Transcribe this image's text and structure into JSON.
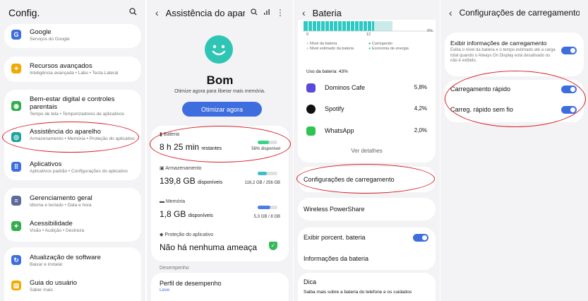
{
  "p1": {
    "title": "Config.",
    "items": [
      {
        "title": "Google",
        "sub": "Serviços do Google",
        "color": "#3d6de0",
        "glyph": "G"
      },
      {
        "title": "Recursos avançados",
        "sub": "Inteligência avançada • Labs • Tecla Lateral",
        "color": "#f2a900",
        "glyph": "✦"
      },
      {
        "title": "Bem-estar digital e controles parentais",
        "sub": "Tempo de tela • Temporizadores de aplicativos",
        "color": "#2fae4b",
        "glyph": "◉"
      },
      {
        "title": "Assistência do aparelho",
        "sub": "Armazenamento • Memória • Proteção do aplicativo",
        "color": "#1aa39a",
        "glyph": "◎"
      },
      {
        "title": "Aplicativos",
        "sub": "Aplicativos padrão • Configurações do aplicativo",
        "color": "#3d6de0",
        "glyph": "⠿"
      },
      {
        "title": "Gerenciamento geral",
        "sub": "Idioma e teclado • Data e hora",
        "color": "#5a6a9a",
        "glyph": "≡"
      },
      {
        "title": "Acessibilidade",
        "sub": "Visão • Audição • Destreza",
        "color": "#2fae4b",
        "glyph": "✦"
      },
      {
        "title": "Atualização de software",
        "sub": "Baixar e instalar",
        "color": "#3d6de0",
        "glyph": "↻"
      },
      {
        "title": "Guia do usuário",
        "sub": "Saber mais",
        "color": "#f2a900",
        "glyph": "▤"
      }
    ]
  },
  "p2": {
    "title": "Assistência do apar...",
    "status": "Bom",
    "status_sub": "Otimize agora para liberar mais memória.",
    "optimize": "Otimizar agora",
    "battery": {
      "label": "Bateria",
      "value": "8 h 25 min",
      "unit": "restantes",
      "pct_text": "56% disponível",
      "level": 0.56
    },
    "storage": {
      "label": "Armazenamento",
      "value": "139,8 GB",
      "unit": "disponíveis",
      "detail": "116,2 GB / 256 GB",
      "level": 0.45
    },
    "memory": {
      "label": "Memória",
      "value": "1,8 GB",
      "unit": "disponíveis",
      "detail": "5,3 GB / 8 GB",
      "level": 0.66
    },
    "protection": {
      "label": "Proteção do aplicativo",
      "value": "Não há nenhuma ameaça"
    },
    "section": "Desempenho",
    "perf": {
      "title": "Perfil de desempenho",
      "sub": "Leve"
    }
  },
  "p3": {
    "title": "Bateria",
    "axis": [
      "0",
      "12",
      "0%"
    ],
    "legend": [
      "Nível da bateria",
      "Carregando",
      "Nível estimado da bateria",
      "Economia de energia"
    ],
    "usage": "Uso da bateria: 43%",
    "apps": [
      {
        "name": "Dominos Cafe",
        "pct": "5,8%",
        "color": "#5b4ad9"
      },
      {
        "name": "Spotify",
        "pct": "4,2%",
        "color": "#111"
      },
      {
        "name": "WhatsApp",
        "pct": "2,0%",
        "color": "#2fc34f"
      }
    ],
    "more": "Ver detalhes",
    "charging": "Configurações de carregamento",
    "wireless": "Wireless PowerShare",
    "show_pct": "Exibir porcent. bateria",
    "info": "Informações da bateria",
    "tip": "Dica",
    "tip_sub": "Saiba mais sobre a bateria do telefone e os cuidados"
  },
  "p4": {
    "title": "Configurações de carregamento",
    "show_info": {
      "title": "Exibir informações de carregamento",
      "sub": "Exiba o nível da bateria e o tempo estimado até a carga total quando o Always On Display está desativado ou não é exibido."
    },
    "fast": "Carregamento rápido",
    "fast_wireless": "Carreg. rápido sem fio"
  }
}
